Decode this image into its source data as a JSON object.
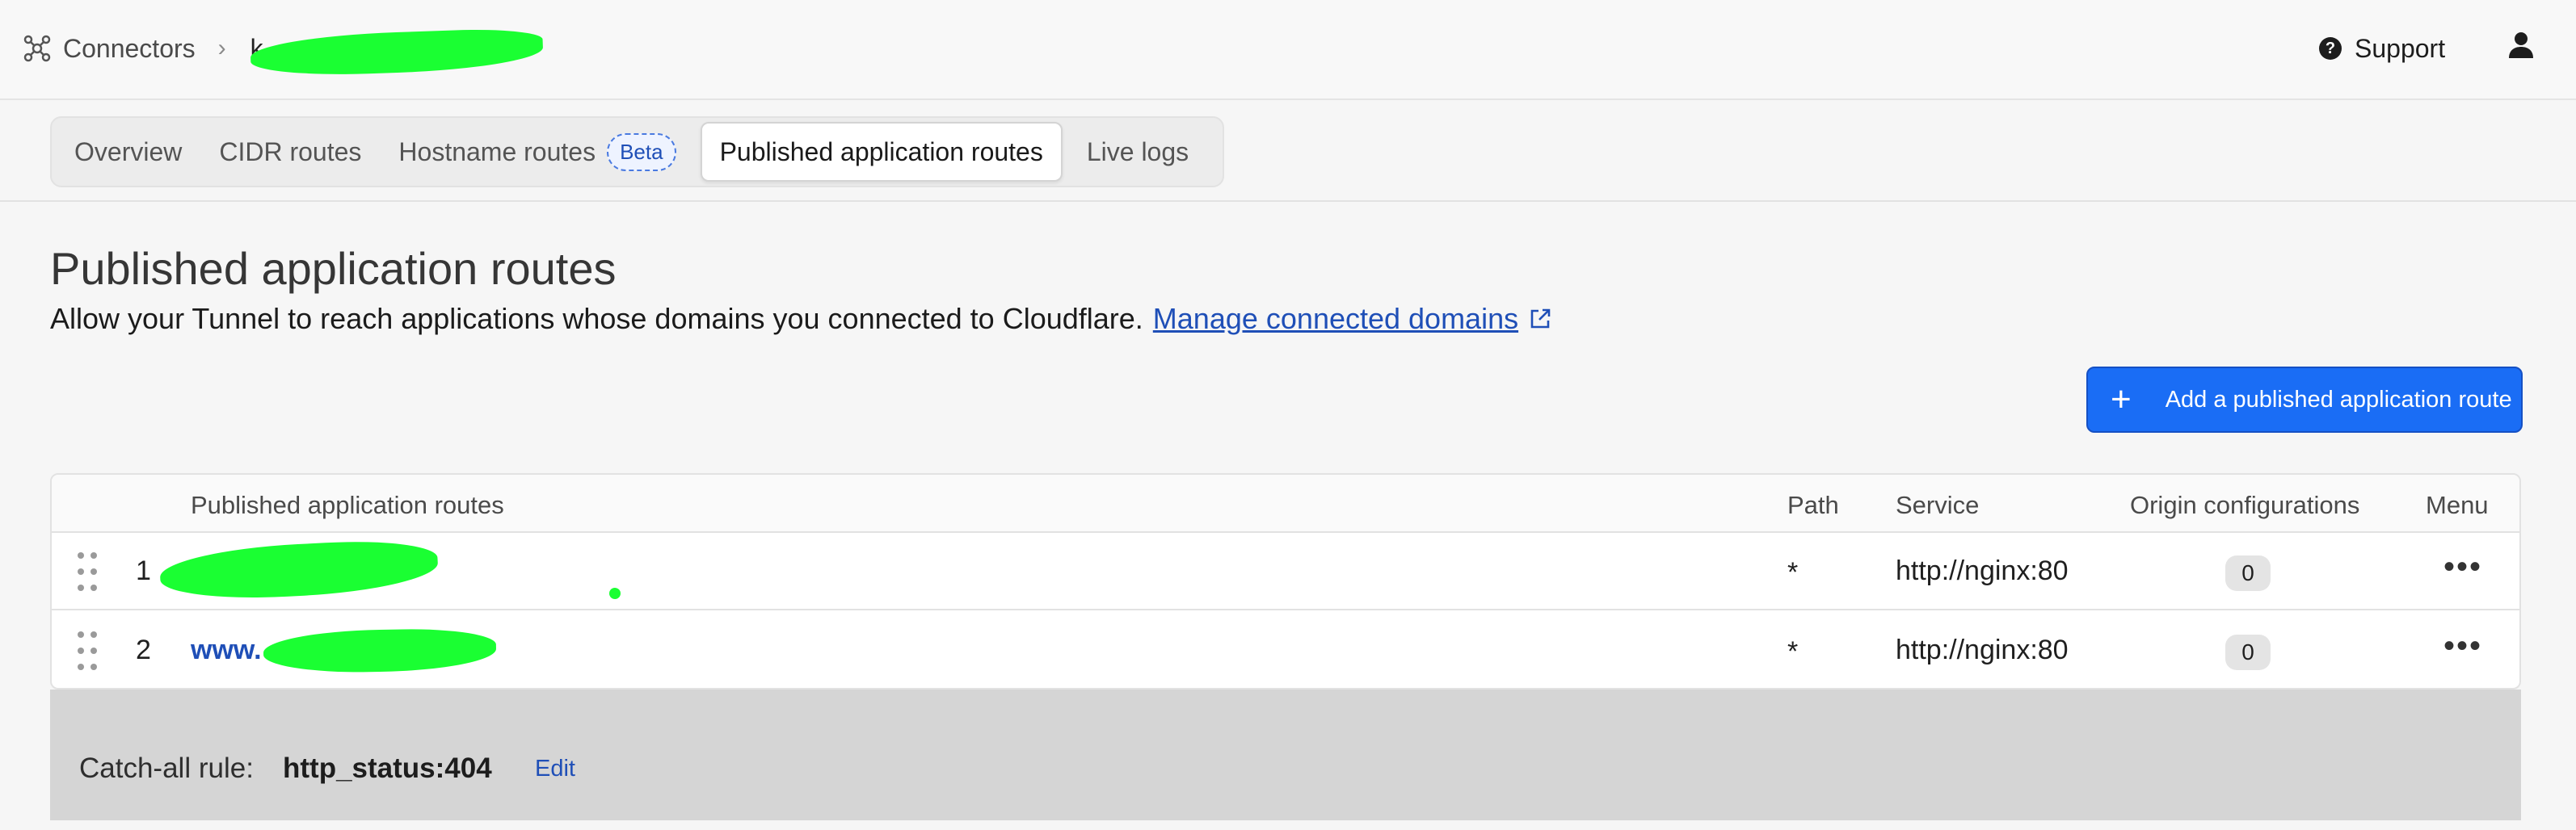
{
  "breadcrumb": {
    "root": "Connectors",
    "tunnel_first_char": "k"
  },
  "header": {
    "support_label": "Support"
  },
  "tabs": [
    {
      "label": "Overview"
    },
    {
      "label": "CIDR routes"
    },
    {
      "label": "Hostname routes",
      "badge": "Beta"
    },
    {
      "label": "Published application routes",
      "active": true
    },
    {
      "label": "Live logs"
    }
  ],
  "page": {
    "title": "Published application routes",
    "description": "Allow your Tunnel to reach applications whose domains you connected to Cloudflare.",
    "manage_link": "Manage connected domains"
  },
  "add_button": {
    "label": "Add a published application route"
  },
  "table": {
    "headers": {
      "routes": "Published application routes",
      "path": "Path",
      "service": "Service",
      "origin": "Origin configurations",
      "menu": "Menu"
    },
    "rows": [
      {
        "num": "1",
        "host": "",
        "path": "*",
        "service": "http://nginx:80",
        "origin": "0"
      },
      {
        "num": "2",
        "host": "www.",
        "path": "*",
        "service": "http://nginx:80",
        "origin": "0"
      }
    ]
  },
  "catch_all": {
    "label": "Catch-all rule:",
    "value": "http_status:404",
    "edit": "Edit"
  },
  "colors": {
    "accent": "#1a6df5",
    "link": "#1f4fb7",
    "redaction": "#1aff32"
  },
  "icons": [
    "connector-icon",
    "chevron-right-icon",
    "help-circle-icon",
    "user-icon",
    "external-link-icon",
    "plus-icon",
    "drag-handle-icon",
    "more-horizontal-icon"
  ]
}
